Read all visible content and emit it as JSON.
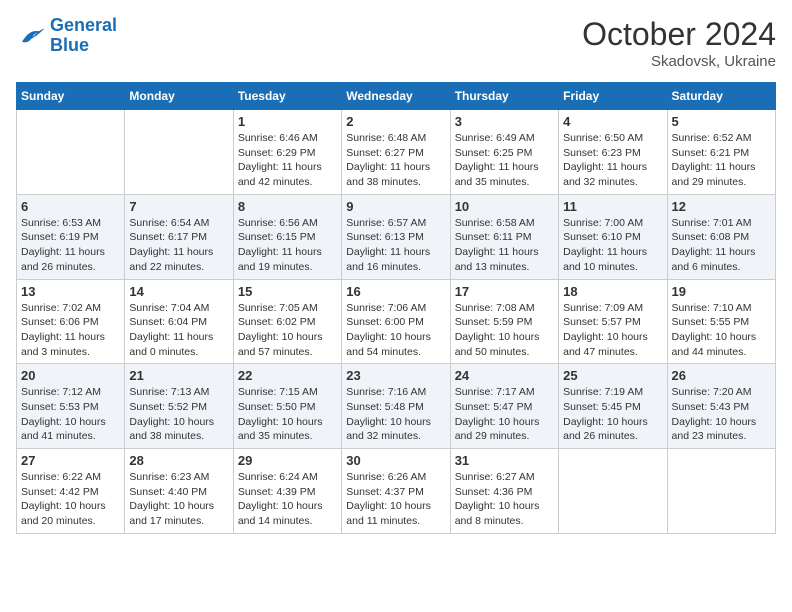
{
  "logo": {
    "line1": "General",
    "line2": "Blue"
  },
  "title": "October 2024",
  "subtitle": "Skadovsk, Ukraine",
  "weekdays": [
    "Sunday",
    "Monday",
    "Tuesday",
    "Wednesday",
    "Thursday",
    "Friday",
    "Saturday"
  ],
  "weeks": [
    [
      {
        "day": "",
        "text": ""
      },
      {
        "day": "",
        "text": ""
      },
      {
        "day": "1",
        "text": "Sunrise: 6:46 AM\nSunset: 6:29 PM\nDaylight: 11 hours and 42 minutes."
      },
      {
        "day": "2",
        "text": "Sunrise: 6:48 AM\nSunset: 6:27 PM\nDaylight: 11 hours and 38 minutes."
      },
      {
        "day": "3",
        "text": "Sunrise: 6:49 AM\nSunset: 6:25 PM\nDaylight: 11 hours and 35 minutes."
      },
      {
        "day": "4",
        "text": "Sunrise: 6:50 AM\nSunset: 6:23 PM\nDaylight: 11 hours and 32 minutes."
      },
      {
        "day": "5",
        "text": "Sunrise: 6:52 AM\nSunset: 6:21 PM\nDaylight: 11 hours and 29 minutes."
      }
    ],
    [
      {
        "day": "6",
        "text": "Sunrise: 6:53 AM\nSunset: 6:19 PM\nDaylight: 11 hours and 26 minutes."
      },
      {
        "day": "7",
        "text": "Sunrise: 6:54 AM\nSunset: 6:17 PM\nDaylight: 11 hours and 22 minutes."
      },
      {
        "day": "8",
        "text": "Sunrise: 6:56 AM\nSunset: 6:15 PM\nDaylight: 11 hours and 19 minutes."
      },
      {
        "day": "9",
        "text": "Sunrise: 6:57 AM\nSunset: 6:13 PM\nDaylight: 11 hours and 16 minutes."
      },
      {
        "day": "10",
        "text": "Sunrise: 6:58 AM\nSunset: 6:11 PM\nDaylight: 11 hours and 13 minutes."
      },
      {
        "day": "11",
        "text": "Sunrise: 7:00 AM\nSunset: 6:10 PM\nDaylight: 11 hours and 10 minutes."
      },
      {
        "day": "12",
        "text": "Sunrise: 7:01 AM\nSunset: 6:08 PM\nDaylight: 11 hours and 6 minutes."
      }
    ],
    [
      {
        "day": "13",
        "text": "Sunrise: 7:02 AM\nSunset: 6:06 PM\nDaylight: 11 hours and 3 minutes."
      },
      {
        "day": "14",
        "text": "Sunrise: 7:04 AM\nSunset: 6:04 PM\nDaylight: 11 hours and 0 minutes."
      },
      {
        "day": "15",
        "text": "Sunrise: 7:05 AM\nSunset: 6:02 PM\nDaylight: 10 hours and 57 minutes."
      },
      {
        "day": "16",
        "text": "Sunrise: 7:06 AM\nSunset: 6:00 PM\nDaylight: 10 hours and 54 minutes."
      },
      {
        "day": "17",
        "text": "Sunrise: 7:08 AM\nSunset: 5:59 PM\nDaylight: 10 hours and 50 minutes."
      },
      {
        "day": "18",
        "text": "Sunrise: 7:09 AM\nSunset: 5:57 PM\nDaylight: 10 hours and 47 minutes."
      },
      {
        "day": "19",
        "text": "Sunrise: 7:10 AM\nSunset: 5:55 PM\nDaylight: 10 hours and 44 minutes."
      }
    ],
    [
      {
        "day": "20",
        "text": "Sunrise: 7:12 AM\nSunset: 5:53 PM\nDaylight: 10 hours and 41 minutes."
      },
      {
        "day": "21",
        "text": "Sunrise: 7:13 AM\nSunset: 5:52 PM\nDaylight: 10 hours and 38 minutes."
      },
      {
        "day": "22",
        "text": "Sunrise: 7:15 AM\nSunset: 5:50 PM\nDaylight: 10 hours and 35 minutes."
      },
      {
        "day": "23",
        "text": "Sunrise: 7:16 AM\nSunset: 5:48 PM\nDaylight: 10 hours and 32 minutes."
      },
      {
        "day": "24",
        "text": "Sunrise: 7:17 AM\nSunset: 5:47 PM\nDaylight: 10 hours and 29 minutes."
      },
      {
        "day": "25",
        "text": "Sunrise: 7:19 AM\nSunset: 5:45 PM\nDaylight: 10 hours and 26 minutes."
      },
      {
        "day": "26",
        "text": "Sunrise: 7:20 AM\nSunset: 5:43 PM\nDaylight: 10 hours and 23 minutes."
      }
    ],
    [
      {
        "day": "27",
        "text": "Sunrise: 6:22 AM\nSunset: 4:42 PM\nDaylight: 10 hours and 20 minutes."
      },
      {
        "day": "28",
        "text": "Sunrise: 6:23 AM\nSunset: 4:40 PM\nDaylight: 10 hours and 17 minutes."
      },
      {
        "day": "29",
        "text": "Sunrise: 6:24 AM\nSunset: 4:39 PM\nDaylight: 10 hours and 14 minutes."
      },
      {
        "day": "30",
        "text": "Sunrise: 6:26 AM\nSunset: 4:37 PM\nDaylight: 10 hours and 11 minutes."
      },
      {
        "day": "31",
        "text": "Sunrise: 6:27 AM\nSunset: 4:36 PM\nDaylight: 10 hours and 8 minutes."
      },
      {
        "day": "",
        "text": ""
      },
      {
        "day": "",
        "text": ""
      }
    ]
  ]
}
